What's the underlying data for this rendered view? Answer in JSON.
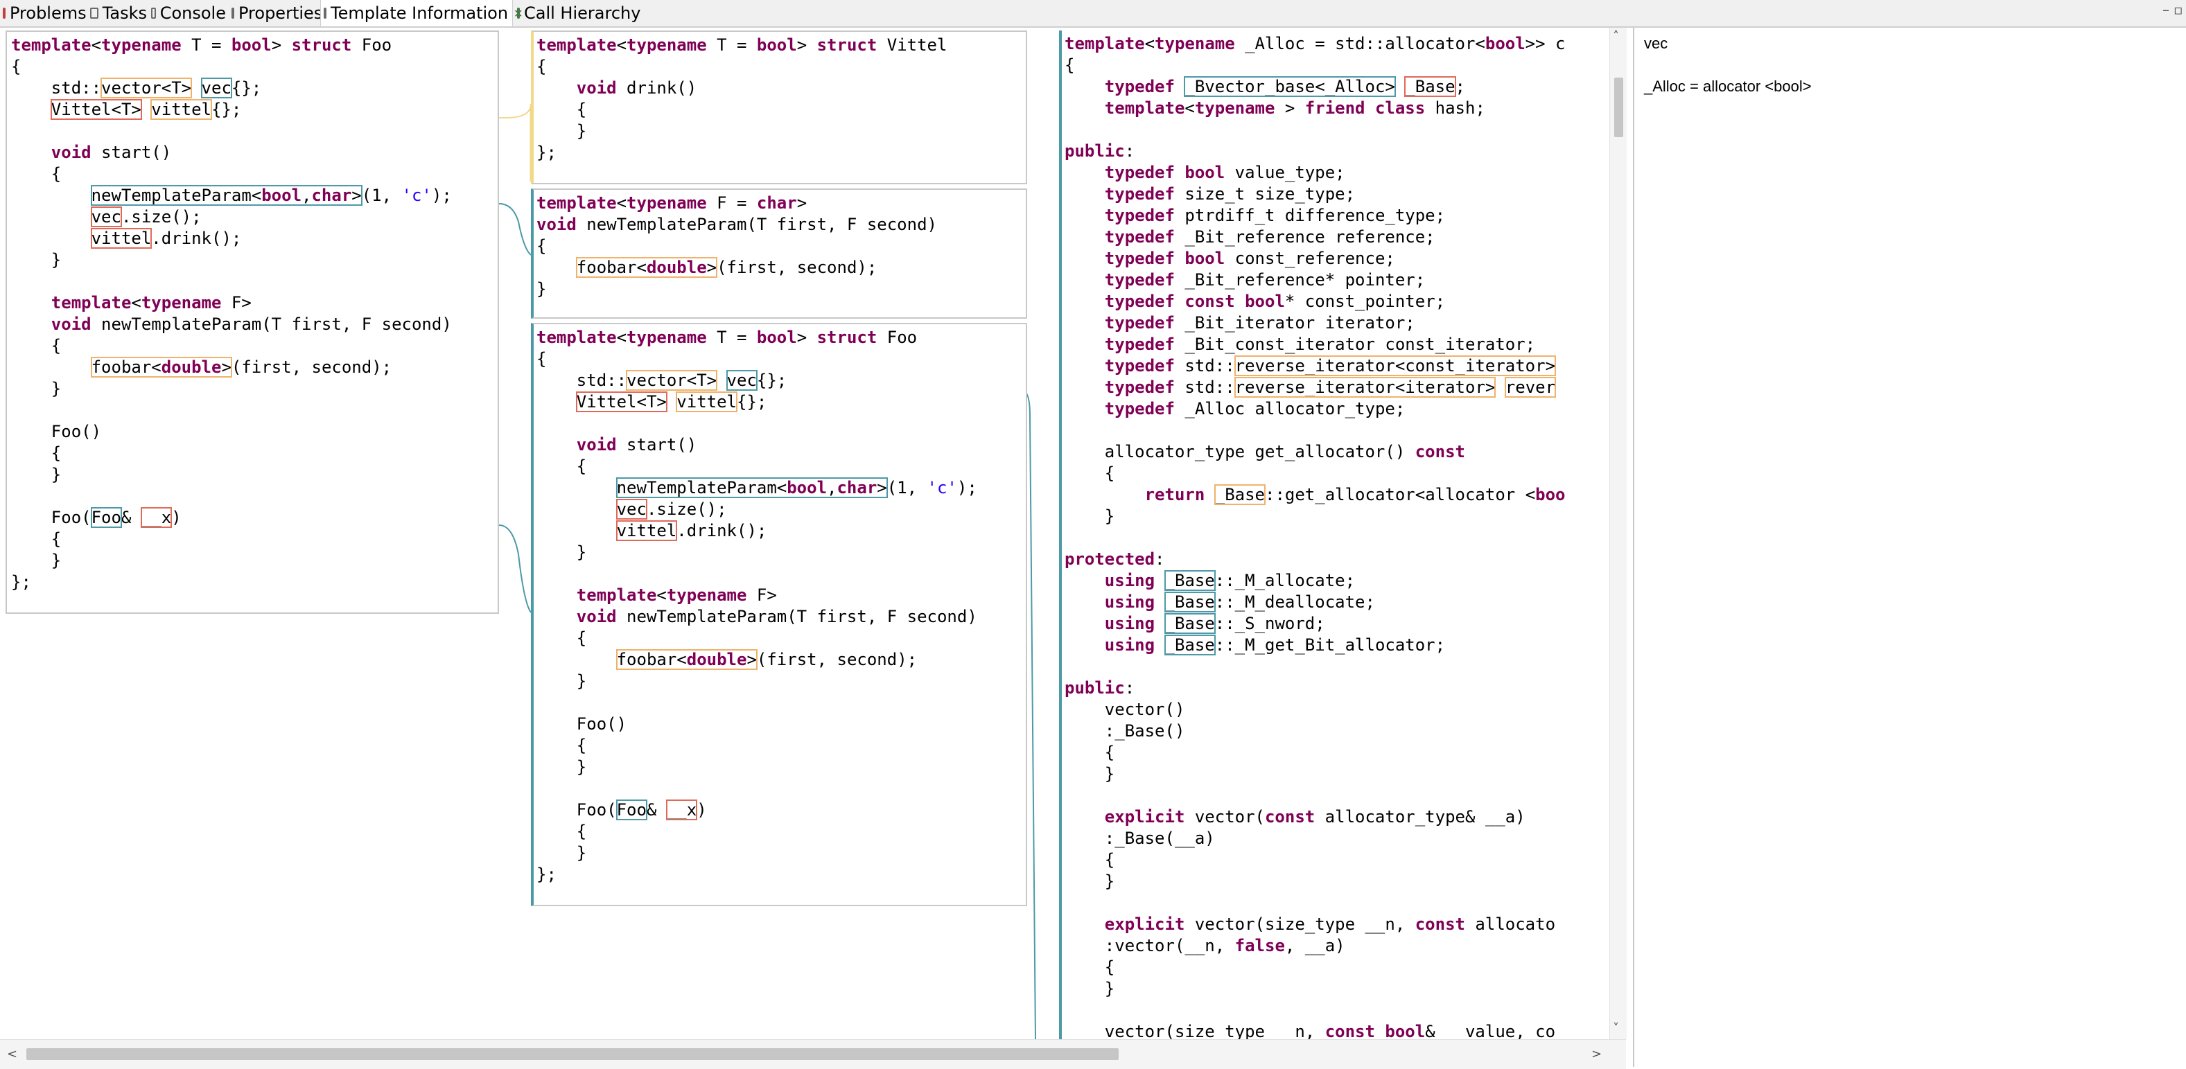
{
  "tabs": [
    {
      "label": "Problems"
    },
    {
      "label": "Tasks"
    },
    {
      "label": "Console"
    },
    {
      "label": "Properties"
    },
    {
      "label": "Template Information",
      "close": "✕"
    },
    {
      "label": "Call Hierarchy"
    }
  ],
  "window_controls": {
    "minimize": "–",
    "maximize": "▫"
  },
  "info": {
    "title": "vec",
    "detail": "_Alloc = allocator <bool>"
  },
  "scroll": {
    "up": "˄",
    "down": "˅",
    "left": "<",
    "right": ">"
  },
  "code": {
    "foo_outline": [
      "template<typename T = bool> struct Foo",
      "{",
      "    std::vector<T> vec{};",
      "    Vittel<T> vittel{};",
      "",
      "    void start()",
      "    {",
      "        newTemplateParam<bool,char>(1, 'c');",
      "        vec.size();",
      "        vittel.drink();",
      "    }",
      "",
      "    template<typename F>",
      "    void newTemplateParam(T first, F second)",
      "    {",
      "        foobar<double>(first, second);",
      "    }",
      "",
      "    Foo()",
      "    {",
      "    }",
      "",
      "    Foo(Foo& __x)",
      "    {",
      "    }",
      "};"
    ],
    "vittel": [
      "template<typename T = bool> struct Vittel",
      "{",
      "    void drink()",
      "    {",
      "    }",
      "};"
    ],
    "newtemplate": [
      "template<typename F = char>",
      "void newTemplateParam(T first, F second)",
      "{",
      "    foobar<double>(first, second);",
      "}"
    ],
    "foo_instance": [
      "template<typename T = bool> struct Foo",
      "{",
      "    std::vector<T> vec{};",
      "    Vittel<T> vittel{};",
      "",
      "    void start()",
      "    {",
      "        newTemplateParam<bool,char>(1, 'c');",
      "        vec.size();",
      "        vittel.drink();",
      "    }",
      "",
      "    template<typename F>",
      "    void newTemplateParam(T first, F second)",
      "    {",
      "        foobar<double>(first, second);",
      "    }",
      "",
      "    Foo()",
      "    {",
      "    }",
      "",
      "    Foo(Foo& __x)",
      "    {",
      "    }",
      "};"
    ],
    "vector": [
      "template<typename _Alloc = std::allocator<bool>> c",
      "{",
      "    typedef _Bvector_base<_Alloc> _Base;",
      "    template<typename > friend class hash;",
      "",
      "public:",
      "    typedef bool value_type;",
      "    typedef size_t size_type;",
      "    typedef ptrdiff_t difference_type;",
      "    typedef _Bit_reference reference;",
      "    typedef bool const_reference;",
      "    typedef _Bit_reference* pointer;",
      "    typedef const bool* const_pointer;",
      "    typedef _Bit_iterator iterator;",
      "    typedef _Bit_const_iterator const_iterator;",
      "    typedef std::reverse_iterator<const_iterator>",
      "    typedef std::reverse_iterator<iterator> rever",
      "    typedef _Alloc allocator_type;",
      "",
      "    allocator_type get_allocator() const",
      "    {",
      "        return _Base::get_allocator<allocator <boo",
      "    }",
      "",
      "protected:",
      "    using _Base::_M_allocate;",
      "    using _Base::_M_deallocate;",
      "    using _Base::_S_nword;",
      "    using _Base::_M_get_Bit_allocator;",
      "",
      "public:",
      "    vector()",
      "    :_Base()",
      "    {",
      "    }",
      "",
      "    explicit vector(const allocator_type& __a)",
      "    :_Base(__a)",
      "    {",
      "    }",
      "",
      "    explicit vector(size_type __n, const allocato",
      "    :vector(__n, false, __a)",
      "    {",
      "    }",
      "",
      "    vector(size_type __n, const bool& __value, co"
    ]
  }
}
